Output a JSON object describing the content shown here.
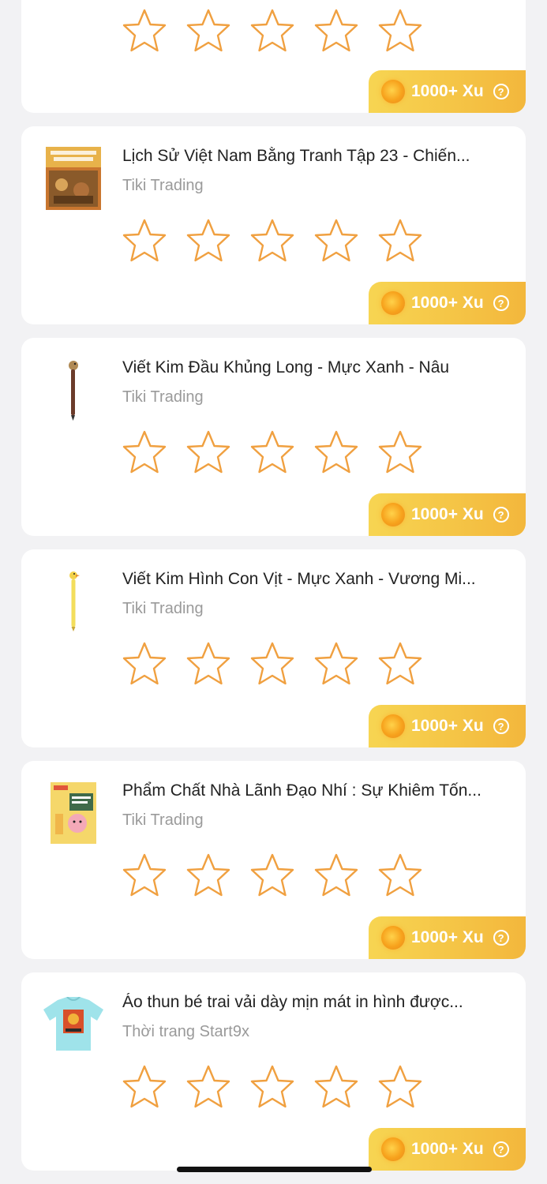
{
  "colors": {
    "star_outline": "#f0a040",
    "reward_gradient_start": "#f7d552",
    "reward_gradient_end": "#f3b73c",
    "seller_text": "#9a9a9a",
    "title_text": "#222222"
  },
  "reward": {
    "label": "1000+ Xu",
    "help_icon": "question-circle-icon",
    "coin_icon": "coin-icon"
  },
  "cards": [
    {
      "title": "",
      "seller": "",
      "rating": 0
    },
    {
      "title": "Lịch Sử Việt Nam Bằng Tranh Tập 23 - Chiến...",
      "seller": "Tiki Trading",
      "rating": 0
    },
    {
      "title": "Viết Kim Đầu Khủng Long - Mực Xanh - Nâu",
      "seller": "Tiki Trading",
      "rating": 0
    },
    {
      "title": "Viết Kim Hình Con Vịt - Mực Xanh - Vương Mi...",
      "seller": "Tiki Trading",
      "rating": 0
    },
    {
      "title": "Phẩm Chất Nhà Lãnh Đạo Nhí : Sự Khiêm Tốn...",
      "seller": "Tiki Trading",
      "rating": 0
    },
    {
      "title": "Áo thun bé trai vải dày mịn mát in hình được...",
      "seller": "Thời trang Start9x",
      "rating": 0
    }
  ]
}
